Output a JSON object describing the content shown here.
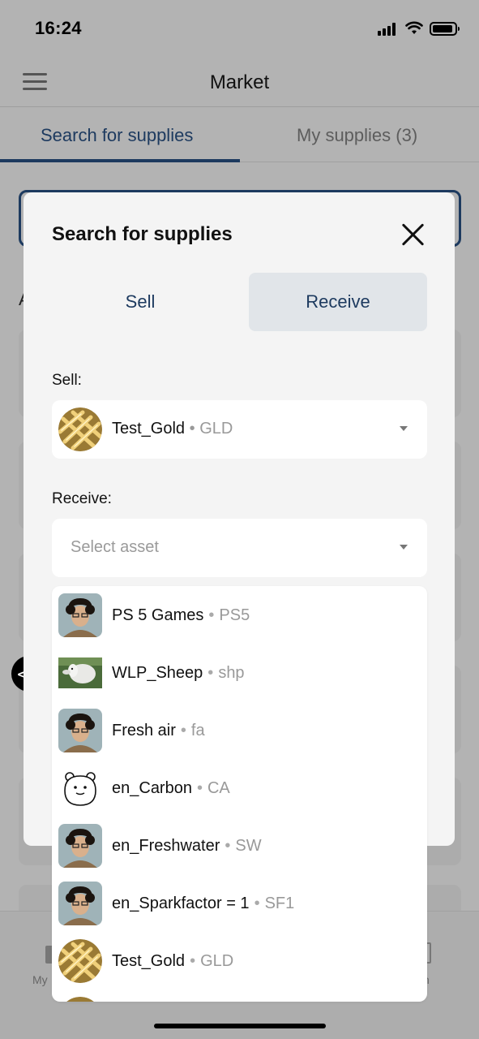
{
  "status": {
    "time": "16:24"
  },
  "appbar": {
    "title": "Market"
  },
  "tabs": [
    {
      "label": "Search for supplies"
    },
    {
      "label": "My supplies (3)"
    }
  ],
  "background": {
    "section_letter": "A",
    "nav_left": "My",
    "nav_right": "n"
  },
  "dev_badge": "</>",
  "modal": {
    "title": "Search for supplies",
    "segments": [
      {
        "label": "Sell"
      },
      {
        "label": "Receive"
      }
    ],
    "sell_label": "Sell:",
    "sell_value": {
      "name": "Test_Gold",
      "code": "GLD"
    },
    "receive_label": "Receive:",
    "receive_placeholder": "Select asset"
  },
  "dropdown": {
    "options": [
      {
        "name": "PS 5 Games",
        "code": "PS5",
        "icon": "person-avatar-icon"
      },
      {
        "name": "WLP_Sheep",
        "code": "shp",
        "icon": "sheep-photo-icon"
      },
      {
        "name": "Fresh air",
        "code": "fa",
        "icon": "person-avatar-icon"
      },
      {
        "name": "en_Carbon",
        "code": "CA",
        "icon": "bear-face-icon"
      },
      {
        "name": "en_Freshwater",
        "code": "SW",
        "icon": "person-avatar-icon"
      },
      {
        "name": "en_Sparkfactor = 1",
        "code": "SF1",
        "icon": "person-avatar-icon"
      },
      {
        "name": "Test_Gold",
        "code": "GLD",
        "icon": "gold-bars-icon"
      }
    ]
  },
  "colors": {
    "accent": "#1d3a5f",
    "overlay": "#b3b3b3",
    "modal_bg": "#f4f4f4",
    "segment_active": "#e1e5e9"
  }
}
